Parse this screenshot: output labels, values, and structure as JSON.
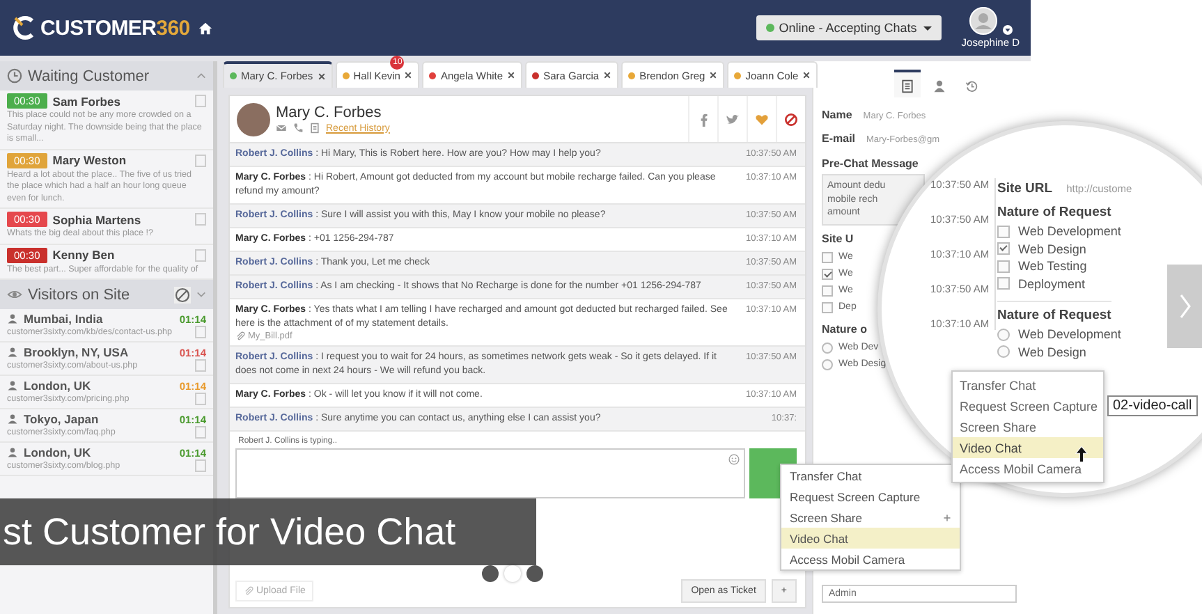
{
  "header": {
    "logo": {
      "name": "CUSTOMER",
      "number": "360"
    },
    "status": {
      "label": "Online - Accepting Chats",
      "color": "#5cb85c"
    },
    "user": "Josephine D"
  },
  "waiting": {
    "title": "Waiting Customer",
    "items": [
      {
        "timer": "00:30",
        "color": "#4cae4c",
        "name": "Sam Forbes",
        "text": "This place could not be any more crowded on a Saturday night. The downside being that the place is small..."
      },
      {
        "timer": "00:30",
        "color": "#e0a43a",
        "name": "Mary Weston",
        "text": "Heard a lot about the place.. The five of us tried the place which had a half an hour long queue even for lunch."
      },
      {
        "timer": "00:30",
        "color": "#e5484d",
        "name": "Sophia Martens",
        "text": "Whats the big deal about this place !?"
      },
      {
        "timer": "00:30",
        "color": "#c9302c",
        "name": "Kenny Ben",
        "text": "The best part... Super affordable for the quality of"
      }
    ]
  },
  "visitors": {
    "title": "Visitors on Site",
    "items": [
      {
        "location": "Mumbai, India",
        "url": "customer3sixty.com/kb/des/contact-us.php",
        "time": "01:14",
        "color": "#4a9a2e"
      },
      {
        "location": "Brooklyn, NY, USA",
        "url": "customer3sixty.com/about-us.php",
        "time": "01:14",
        "color": "#d9534f"
      },
      {
        "location": "London, UK",
        "url": "customer3sixty.com/pricing.php",
        "time": "01:14",
        "color": "#e89a2c"
      },
      {
        "location": "Tokyo, Japan",
        "url": "customer3sixty.com/faq.php",
        "time": "01:14",
        "color": "#4a9a2e"
      },
      {
        "location": "London, UK",
        "url": "customer3sixty.com/blog.php",
        "time": "01:14",
        "color": "#4a9a2e"
      }
    ]
  },
  "chat_tabs": [
    {
      "name": "Mary C. Forbes",
      "color": "#5cb85c",
      "selected": true
    },
    {
      "name": "Hall Kevin",
      "color": "#e8a838",
      "selected": false,
      "badge": "10"
    },
    {
      "name": "Angela White",
      "color": "#e0403c",
      "selected": false
    },
    {
      "name": "Sara Garcia",
      "color": "#c9302c",
      "selected": false
    },
    {
      "name": "Brendon Greg",
      "color": "#e8a838",
      "selected": false
    },
    {
      "name": "Joann Cole",
      "color": "#e8a838",
      "selected": false
    }
  ],
  "contact": {
    "name": "Mary C. Forbes",
    "history_link": "Recent History"
  },
  "messages": [
    {
      "kind": "agent",
      "sender": "Robert J. Collins",
      "text": ": Hi Mary, This is Robert here. How are you? How may I help you?",
      "time": "10:37:50 AM"
    },
    {
      "kind": "customer",
      "sender": "Mary C. Forbes",
      "text": ": Hi Robert, Amount got deducted from my account but mobile recharge failed. Can you please refund my amount?",
      "time": "10:37:10 AM"
    },
    {
      "kind": "agent",
      "sender": "Robert J. Collins",
      "text": ": Sure I will assist you with this, May I know your mobile no please?",
      "time": "10:37:50 AM"
    },
    {
      "kind": "customer",
      "sender": "Mary C. Forbes",
      "text": ": +01 1256-294-787",
      "time": "10:37:10 AM"
    },
    {
      "kind": "agent",
      "sender": "Robert J. Collins",
      "text": ": Thank you, Let me check",
      "time": "10:37:50 AM"
    },
    {
      "kind": "agent",
      "sender": "Robert J. Collins",
      "text": ": As I am checking - It shows that No Recharge is done for the number +01 1256-294-787",
      "time": "10:37:50 AM"
    },
    {
      "kind": "customer",
      "sender": "Mary C. Forbes",
      "text": ": Yes thats what I am telling I have recharged and amount got deducted but recharged failed. See here is the attachment of of my statement details.",
      "time": "10:37:10 AM",
      "attachment": "My_Bill.pdf"
    },
    {
      "kind": "agent",
      "sender": "Robert J. Collins",
      "text": ": I request you to wait for 24 hours, as sometimes network gets weak - So it gets delayed. If it does not come in next 24 hours - We will refund you back.",
      "time": "10:37:50 AM"
    },
    {
      "kind": "customer",
      "sender": "Mary C. Forbes",
      "text": ": Ok - will let you know if it will not come.",
      "time": "10:37:10 AM"
    },
    {
      "kind": "agent",
      "sender": "Robert J. Collins",
      "text": ": Sure anytime you can contact us, anything else I can assist you?",
      "time": "10:37:"
    }
  ],
  "composer": {
    "typing": "Robert J. Collins is typing..",
    "upload": "Upload File",
    "ticket": "Open as Ticket",
    "more": "+"
  },
  "menu": [
    {
      "label": "Transfer Chat",
      "selected": false,
      "plus": false
    },
    {
      "label": "Request Screen Capture",
      "selected": false,
      "plus": false
    },
    {
      "label": "Screen Share",
      "selected": false,
      "plus": true
    },
    {
      "label": "Video Chat",
      "selected": true,
      "plus": false
    },
    {
      "label": "Access Mobil Camera",
      "selected": false,
      "plus": false
    }
  ],
  "info": {
    "fields": [
      {
        "label": "Name",
        "value": "Mary C. Forbes"
      },
      {
        "label": "E-mail",
        "value": "Mary-Forbes@gm"
      }
    ],
    "prechat_label": "Pre-Chat Message",
    "prechat": "Amount dedu\nmobile rech\namount",
    "site_label": "Site U",
    "checks": [
      {
        "label": "We",
        "checked": false
      },
      {
        "label": "We",
        "checked": true
      },
      {
        "label": "We",
        "checked": false
      },
      {
        "label": "Dep",
        "checked": false
      }
    ],
    "radio_label": "Nature o",
    "radios": [
      {
        "label": "Web Dev",
        "selected": false
      },
      {
        "label": "Web Desig",
        "selected": false
      }
    ],
    "assignee": "Admin"
  },
  "magnifier": {
    "times": [
      "10:37:50 AM",
      "10:37:50 AM",
      "10:37:10 AM",
      "10:37:50 AM",
      "10:37:10 AM"
    ],
    "site_label": "Site URL",
    "site_value": "http://custome",
    "check_title": "Nature of Request",
    "checks": [
      {
        "label": "Web Development",
        "checked": false
      },
      {
        "label": "Web Design",
        "checked": true
      },
      {
        "label": "Web Testing",
        "checked": false
      },
      {
        "label": "Deployment",
        "checked": false
      }
    ],
    "radio_title": "Nature of Request",
    "radios": [
      {
        "label": "Web Development",
        "selected": false
      },
      {
        "label": "Web Design",
        "selected": false
      }
    ],
    "menu": [
      {
        "label": "Transfer Chat",
        "selected": false
      },
      {
        "label": "Request Screen Capture",
        "selected": false
      },
      {
        "label": "Screen Share",
        "selected": false
      },
      {
        "label": "Video Chat",
        "selected": true
      },
      {
        "label": "Access Mobil Camera",
        "selected": false
      }
    ],
    "tooltip": "02-video-call"
  },
  "slide": {
    "caption": "st Customer for Video Chat",
    "dots": [
      {
        "selected": false
      },
      {
        "selected": true
      },
      {
        "selected": false
      }
    ]
  }
}
